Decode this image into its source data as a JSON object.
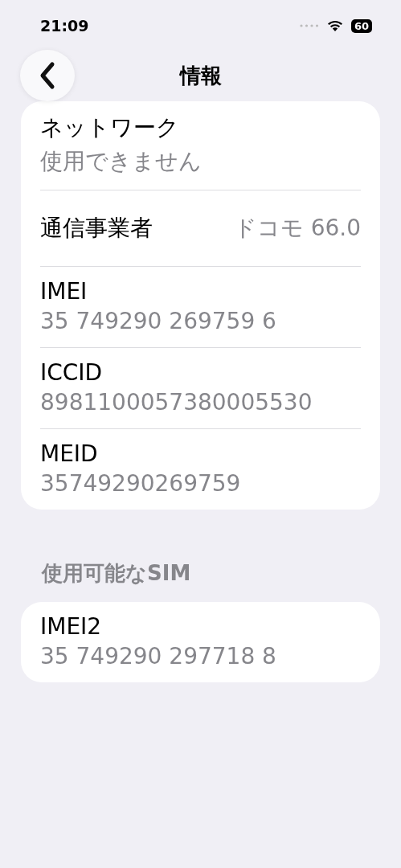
{
  "status_bar": {
    "time": "21:09",
    "battery": "60"
  },
  "nav": {
    "title": "情報"
  },
  "info_rows": [
    {
      "kind": "stacked",
      "label": "ネットワーク",
      "value": "使用できません"
    },
    {
      "kind": "inline",
      "label": "通信事業者",
      "value": "ドコモ 66.0"
    },
    {
      "kind": "stacked",
      "label": "IMEI",
      "value": "35 749290 269759 6"
    },
    {
      "kind": "stacked",
      "label": "ICCID",
      "value": "8981100057380005530"
    },
    {
      "kind": "stacked",
      "label": "MEID",
      "value": "35749290269759"
    }
  ],
  "available_sim": {
    "header": "使用可能なSIM",
    "rows": [
      {
        "kind": "stacked",
        "label": "IMEI2",
        "value": "35 749290 297718 8"
      }
    ]
  }
}
